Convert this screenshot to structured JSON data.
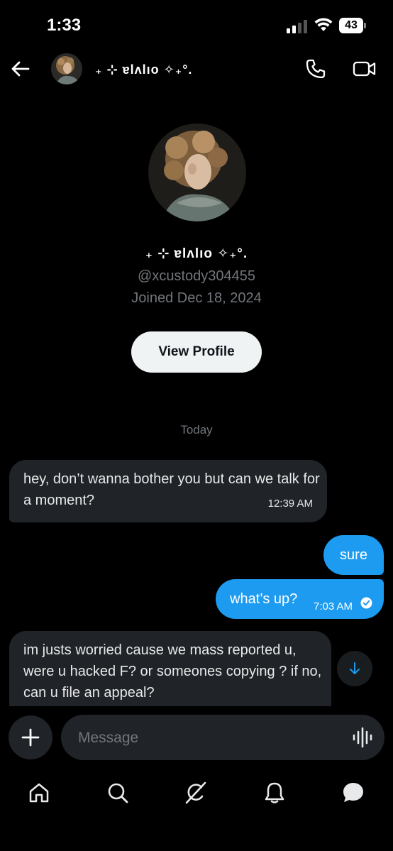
{
  "status_bar": {
    "time": "1:33",
    "battery": "43"
  },
  "header": {
    "name": "₊ ⊹ ɐlʌlıo ✧₊°."
  },
  "profile": {
    "name": "₊ ⊹ ɐlʌlıo ✧₊°.",
    "handle": "@xcustody304455",
    "joined": "Joined Dec 18, 2024",
    "view_profile_label": "View Profile"
  },
  "conversation": {
    "date_divider": "Today",
    "messages": [
      {
        "direction": "incoming",
        "text": "hey, don’t wanna bother you but can we talk for a moment?",
        "time": "12:39 AM"
      },
      {
        "direction": "outgoing",
        "text": "sure",
        "time": ""
      },
      {
        "direction": "outgoing",
        "text": "what’s up?",
        "time": "7:03 AM",
        "read": true
      },
      {
        "direction": "incoming",
        "text": "im justs worried cause we mass reported u, were u hacked F? or someones copying ? if no, can u file an appeal?",
        "time": ""
      }
    ]
  },
  "composer": {
    "placeholder": "Message"
  },
  "bottom_nav": {
    "items": [
      "home-icon",
      "search-icon",
      "grok-icon",
      "notifications-icon",
      "messages-icon"
    ],
    "active": "messages-icon"
  },
  "colors": {
    "accent": "#1d9bf0",
    "bubble_incoming": "#202327",
    "muted": "#71767b"
  }
}
